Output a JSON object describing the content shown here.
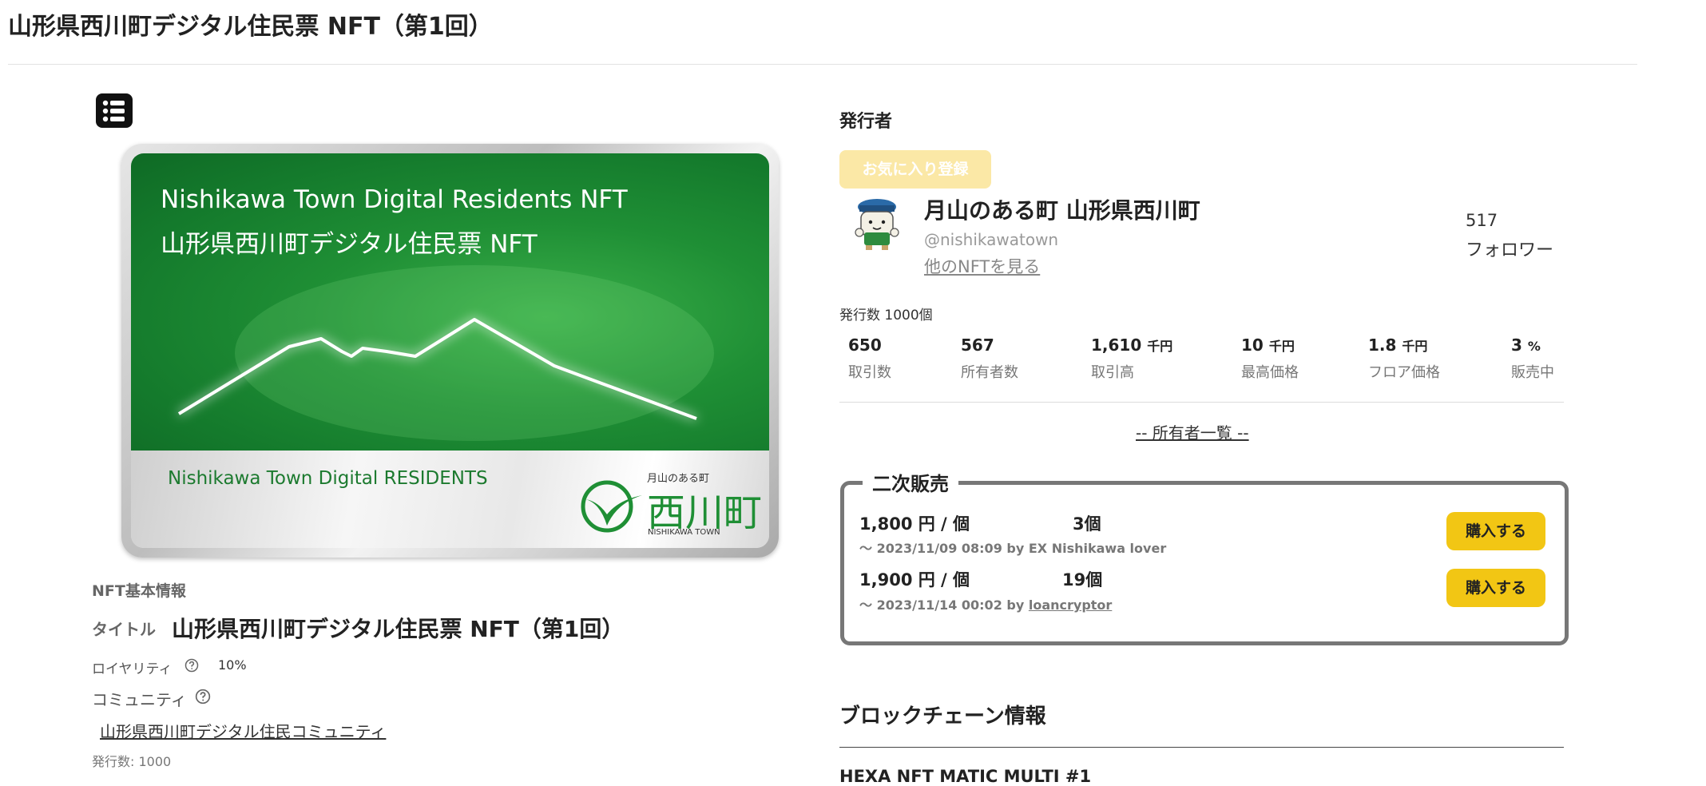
{
  "page": {
    "title": "山形県西川町デジタル住民票 NFT（第1回）"
  },
  "nft_image": {
    "title_en": "Nishikawa Town Digital Residents NFT",
    "title_ja": "山形県西川町デジタル住民票 NFT",
    "subtitle": "Nishikawa Town Digital RESIDENTS",
    "logo_small": "月山のある町",
    "logo_big": "西川町",
    "logo_en": "NISHIKAWA TOWN",
    "green": "#1f8f35"
  },
  "basic_info": {
    "heading": "NFT基本情報",
    "title_label": "タイトル",
    "title_value": "山形県西川町デジタル住民票 NFT（第1回）",
    "royalty_label": "ロイヤリティ",
    "royalty_value": "10%",
    "community_label": "コミュニティ",
    "community_link": "山形県西川町デジタル住民コミュニティ",
    "issued": "発行数: 1000"
  },
  "issuer": {
    "heading": "発行者",
    "favorite_button": "お気に入り登録",
    "name": "月山のある町 山形県西川町",
    "handle": "@nishikawatown",
    "more_link": "他のNFTを見る",
    "followers_count": "517",
    "followers_label": "フォロワー"
  },
  "stats": {
    "issued": "発行数 1000個",
    "items": [
      {
        "value": "650",
        "unit": "",
        "label": "取引数"
      },
      {
        "value": "567",
        "unit": "",
        "label": "所有者数"
      },
      {
        "value": "1,610",
        "unit": "千円",
        "label": "取引高"
      },
      {
        "value": "10",
        "unit": "千円",
        "label": "最高価格"
      },
      {
        "value": "1.8",
        "unit": "千円",
        "label": "フロア価格"
      },
      {
        "value": "3",
        "unit": "%",
        "label": "販売中"
      }
    ],
    "owners_link": "-- 所有者一覧 --"
  },
  "secondary": {
    "heading": "二次販売",
    "listings": [
      {
        "price": "1,800 円 / 個",
        "qty": "3個",
        "meta_prefix": "〜 2023/11/09 08:09 by ",
        "seller": "EX Nishikawa lover",
        "buy": "購入する"
      },
      {
        "price": "1,900 円 / 個",
        "qty": "19個",
        "meta_prefix": "〜 2023/11/14 00:02 by ",
        "seller": "loancryptor",
        "buy": "購入する"
      }
    ]
  },
  "blockchain": {
    "heading": "ブロックチェーン情報",
    "item": "HEXA NFT MATIC MULTI #1"
  }
}
